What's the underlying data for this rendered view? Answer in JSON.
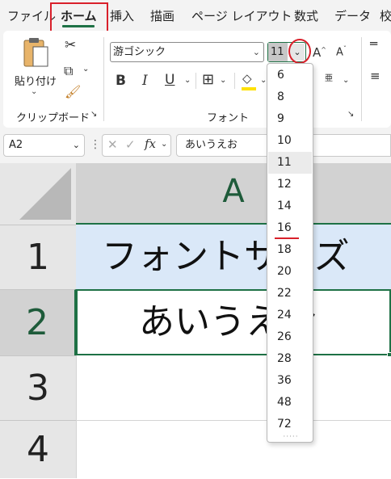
{
  "tabs": {
    "file": "ファイル",
    "home": "ホーム",
    "insert": "挿入",
    "draw": "描画",
    "page_layout": "ページ レイアウト",
    "formulas": "数式",
    "data": "データ",
    "review_partial": "校"
  },
  "clipboard": {
    "paste_label": "貼り付け",
    "group_label": "クリップボード"
  },
  "font_group": {
    "font_name": "游ゴシック",
    "font_size": "11",
    "group_label": "フォント",
    "phonetic_label": "亜"
  },
  "formula_bar": {
    "name_box": "A2",
    "fx_label": "fx",
    "content": "あいうえお"
  },
  "sheet": {
    "column_A": "A",
    "rows": [
      "1",
      "2",
      "3",
      "4"
    ],
    "cell_A1": "フォントサイズ",
    "cell_A2": "あいうえお"
  },
  "font_size_dropdown": {
    "options": [
      "6",
      "8",
      "9",
      "10",
      "11",
      "12",
      "14",
      "16",
      "18",
      "20",
      "22",
      "24",
      "26",
      "28",
      "36",
      "48",
      "72"
    ],
    "selected": "11",
    "annotated": "16"
  },
  "colors": {
    "accent_green": "#1e7145",
    "annotation_red": "#d9202b",
    "cell_fill_A1": "#dae8f8"
  }
}
